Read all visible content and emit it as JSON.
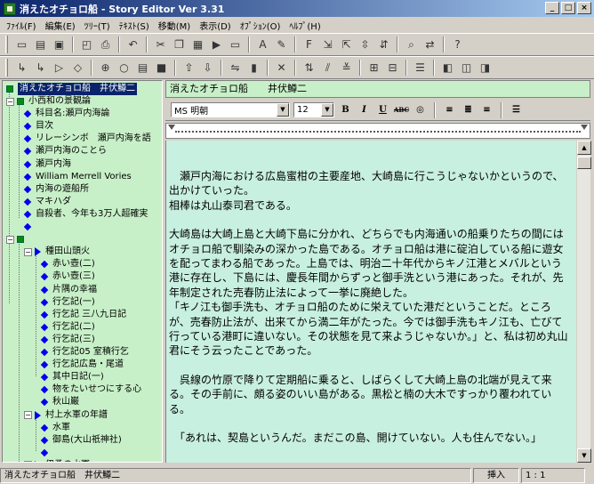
{
  "window": {
    "title": "消えたオチョロ船 - Story Editor Ver 3.31",
    "minimize_label": "_",
    "maximize_label": "□",
    "close_label": "×"
  },
  "menu": [
    "ﾌｧｲﾙ(F)",
    "編集(E)",
    "ﾂﾘｰ(T)",
    "ﾃｷｽﾄ(S)",
    "移動(M)",
    "表示(D)",
    "ｵﾌﾟｼｮﾝ(O)",
    "ﾍﾙﾌﾟ(H)"
  ],
  "toolbar_icons_row1": [
    "new-document-icon",
    "open-icon",
    "save-icon",
    "print-preview-icon",
    "print-icon",
    "undo-icon",
    "cut-icon",
    "copy-icon",
    "paste-icon",
    "insert-icon",
    "layout-icon",
    "font-icon",
    "color-icon",
    "style-icon",
    "outline-icon",
    "bold-icon",
    "find-icon",
    "replace-icon",
    "help-icon"
  ],
  "tree": {
    "root_label": "消えたオチョロ船　井伏鱒二",
    "items": [
      {
        "label": "小西和の景観論",
        "depth": 1,
        "marker": "square",
        "expander": "−"
      },
      {
        "label": "科目名:瀬戸内海論",
        "depth": 2,
        "marker": "diamond"
      },
      {
        "label": "目次",
        "depth": 2,
        "marker": "diamond"
      },
      {
        "label": "リレーシンボ　瀬戸内海を語",
        "depth": 2,
        "marker": "diamond"
      },
      {
        "label": "瀬戸内海のことら",
        "depth": 2,
        "marker": "diamond"
      },
      {
        "label": "瀬戸内海",
        "depth": 2,
        "marker": "diamond"
      },
      {
        "label": "William Merrell Vories",
        "depth": 2,
        "marker": "diamond"
      },
      {
        "label": "内海の遊船所",
        "depth": 2,
        "marker": "diamond"
      },
      {
        "label": "マキハダ",
        "depth": 2,
        "marker": "diamond"
      },
      {
        "label": "自殺者、今年も3万人超確実",
        "depth": 2,
        "marker": "diamond"
      },
      {
        "label": "",
        "depth": 2,
        "marker": "diamond"
      },
      {
        "label": "",
        "depth": 1,
        "marker": "square",
        "expander": "−"
      },
      {
        "label": "種田山頭火",
        "depth": 2,
        "marker": "triangle",
        "expander": "−"
      },
      {
        "label": "赤い壺(二)",
        "depth": 3,
        "marker": "diamond"
      },
      {
        "label": "赤い壺(三)",
        "depth": 3,
        "marker": "diamond"
      },
      {
        "label": "片隅の幸福",
        "depth": 3,
        "marker": "diamond"
      },
      {
        "label": "行乞記(一)",
        "depth": 3,
        "marker": "diamond"
      },
      {
        "label": "行乞記 三八九日記",
        "depth": 3,
        "marker": "diamond"
      },
      {
        "label": "行乞記(二)",
        "depth": 3,
        "marker": "diamond"
      },
      {
        "label": "行乞記(三)",
        "depth": 3,
        "marker": "diamond"
      },
      {
        "label": "行乞記05 室積行乞",
        "depth": 3,
        "marker": "diamond"
      },
      {
        "label": "行乞記広島・尾道",
        "depth": 3,
        "marker": "diamond"
      },
      {
        "label": "其中日記(一)",
        "depth": 3,
        "marker": "diamond"
      },
      {
        "label": "物をたいせつにする心",
        "depth": 3,
        "marker": "diamond"
      },
      {
        "label": "秋山巌",
        "depth": 3,
        "marker": "diamond"
      },
      {
        "label": "村上水軍の年譜",
        "depth": 2,
        "marker": "triangle",
        "expander": "−"
      },
      {
        "label": "水軍",
        "depth": 3,
        "marker": "diamond"
      },
      {
        "label": "御島(大山祇神社)",
        "depth": 3,
        "marker": "diamond"
      },
      {
        "label": "",
        "depth": 3,
        "marker": "diamond"
      },
      {
        "label": "伊予の水軍",
        "depth": 2,
        "marker": "triangle",
        "expander": "+"
      }
    ]
  },
  "document": {
    "title": "消えたオチョロ船　　井伏鱒二",
    "font_name": "MS 明朝",
    "font_size": "12",
    "format_buttons": [
      "B",
      "I",
      "U",
      "ABC"
    ],
    "paragraphs": [
      "　瀬戸内海における広島蜜柑の主要産地、大崎島に行こうじゃないかというので、出かけていった。",
      "相棒は丸山泰司君である。",
      "",
      "大崎島は大崎上島と大崎下島に分かれ、どちらでも内海通いの船乗りたちの間にはオチョロ船で馴染みの深かった島である。オチョロ船は港に碇泊している船に遊女を配ってまわる船であった。上島では、明治二十年代からキノ江港とメバルという港に存在し、下島には、慶長年間からずっと御手洗という港にあった。それが、先年制定された売春防止法によって一挙に廃絶した。",
      "「キノ江も御手洗も、オチョロ船のために栄えていた港だということだ。ところが、売春防止法が、出来てから満二年がたった。今では御手洗もキノ江も、亡びて行っている港町に違いない。その状態を見て来ようじゃないか。」と、私は初め丸山君にそう云ったことであった。",
      "",
      "　呉線の竹原で降りて定期船に乗ると、しばらくして大崎上島の北端が見えて来る。その手前に、頗る姿のいい島がある。黒松と楠の大木ですっかり覆われている。",
      "",
      "　「あれは、契島というんだ。まだこの島、開けていない。人も住んでない。」"
    ]
  },
  "status": {
    "doc_name": "消えたオチョロ船　井伏鱒二",
    "mode": "挿入",
    "position": "1 : 1"
  }
}
